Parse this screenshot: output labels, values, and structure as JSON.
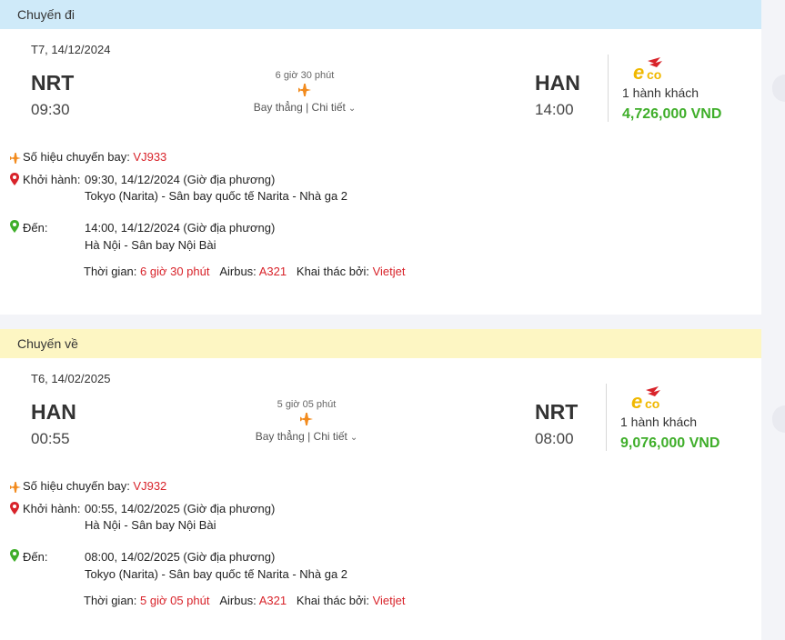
{
  "outbound": {
    "header": "Chuyến đi",
    "date": "T7, 14/12/2024",
    "from_code": "NRT",
    "from_time": "09:30",
    "to_code": "HAN",
    "to_time": "14:00",
    "duration": "6 giờ 30 phút",
    "route_type": "Bay thẳng | Chi tiết",
    "passengers": "1 hành khách",
    "price": "4,726,000 VND",
    "flight_no_label": "Số hiệu chuyến bay: ",
    "flight_no": "VJ933",
    "depart_label": "Khởi hành:",
    "depart_time": "09:30, 14/12/2024 (Giờ địa phương)",
    "depart_place": "Tokyo (Narita) - Sân bay quốc tế Narita - Nhà ga 2",
    "arrive_label": "Đến:",
    "arrive_time": "14:00, 14/12/2024 (Giờ địa phương)",
    "arrive_place": "Hà Nội - Sân bay Nội Bài",
    "duration_label": "Thời gian: ",
    "duration_value": "6 giờ 30 phút",
    "aircraft_label": "Airbus: ",
    "aircraft_value": "A321",
    "operator_label": "Khai thác bởi: ",
    "operator_value": "Vietjet"
  },
  "return": {
    "header": "Chuyến về",
    "date": "T6, 14/02/2025",
    "from_code": "HAN",
    "from_time": "00:55",
    "to_code": "NRT",
    "to_time": "08:00",
    "duration": "5 giờ 05 phút",
    "route_type": "Bay thẳng | Chi tiết",
    "passengers": "1 hành khách",
    "price": "9,076,000 VND",
    "flight_no_label": "Số hiệu chuyến bay: ",
    "flight_no": "VJ932",
    "depart_label": "Khởi hành:",
    "depart_time": "00:55, 14/02/2025 (Giờ địa phương)",
    "depart_place": "Hà Nội - Sân bay Nội Bài",
    "arrive_label": "Đến:",
    "arrive_time": "08:00, 14/02/2025 (Giờ địa phương)",
    "arrive_place": "Tokyo (Narita) - Sân bay quốc tế Narita - Nhà ga 2",
    "duration_label": "Thời gian: ",
    "duration_value": "5 giờ 05 phút",
    "aircraft_label": "Airbus: ",
    "aircraft_value": "A321",
    "operator_label": "Khai thác bởi: ",
    "operator_value": "Vietjet"
  },
  "fare_logo_text": "eco",
  "icons": {
    "plane": "airplane-icon",
    "depart_pin": "departure-pin-icon",
    "arrive_pin": "arrival-pin-icon",
    "details": "chevron-down-icon"
  },
  "colors": {
    "price_green": "#3fae2a",
    "accent_red": "#d8232a",
    "outbound_header_bg": "#cfeaf9",
    "return_header_bg": "#fdf6c3"
  }
}
